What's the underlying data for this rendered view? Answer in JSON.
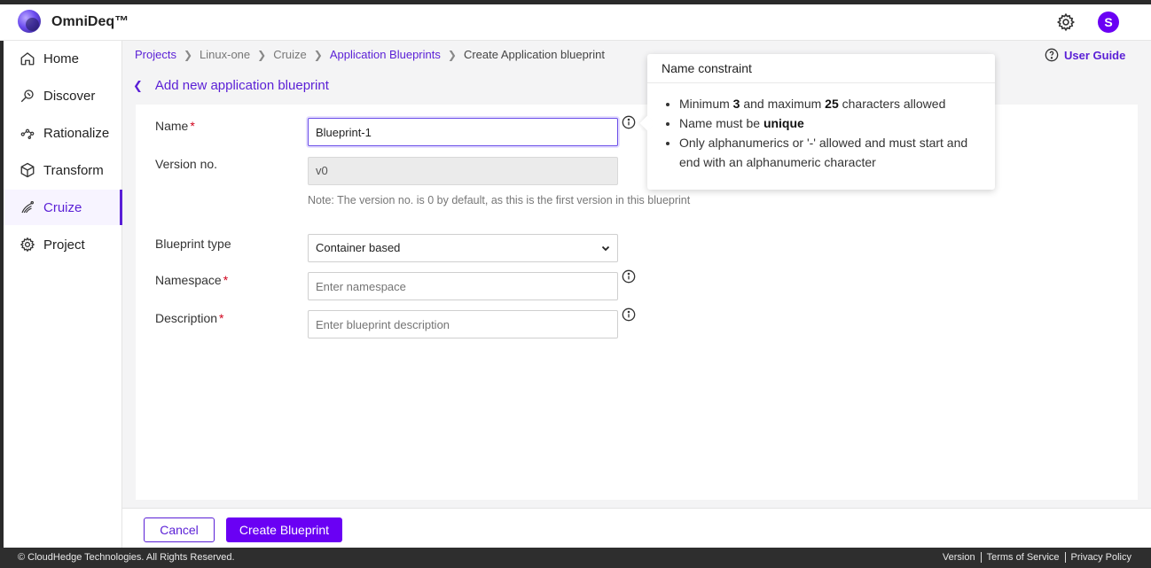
{
  "app": {
    "brand": "OmniDeq™",
    "avatar_initial": "S"
  },
  "sidebar": {
    "items": [
      {
        "label": "Home",
        "icon": "home-icon"
      },
      {
        "label": "Discover",
        "icon": "discover-icon"
      },
      {
        "label": "Rationalize",
        "icon": "rationalize-icon"
      },
      {
        "label": "Transform",
        "icon": "transform-icon"
      },
      {
        "label": "Cruize",
        "icon": "cruize-icon",
        "active": true
      },
      {
        "label": "Project",
        "icon": "gear-icon"
      }
    ]
  },
  "breadcrumb": {
    "items": [
      "Projects",
      "Linux-one",
      "Cruize",
      "Application Blueprints",
      "Create Application blueprint"
    ]
  },
  "user_guide": "User Guide",
  "page": {
    "back_title": "Add new application blueprint"
  },
  "form": {
    "name": {
      "label": "Name",
      "value": "Blueprint-1"
    },
    "version": {
      "label": "Version no.",
      "value": "v0",
      "note": "Note: The version no. is 0 by default, as this is the first version in this blueprint"
    },
    "blueprint_type": {
      "label": "Blueprint type",
      "value": "Container based"
    },
    "namespace": {
      "label": "Namespace",
      "placeholder": "Enter namespace"
    },
    "description": {
      "label": "Description",
      "placeholder": "Enter blueprint description"
    }
  },
  "tooltip": {
    "title": "Name constraint",
    "rule1": {
      "pre": "Minimum ",
      "b1": "3",
      "mid": " and maximum ",
      "b2": "25",
      "post": " characters allowed"
    },
    "rule2": {
      "pre": "Name must be ",
      "b1": "unique"
    },
    "rule3": "Only alphanumerics or '-' allowed and must start and end with an alphanumeric character"
  },
  "actions": {
    "cancel": "Cancel",
    "create": "Create Blueprint"
  },
  "footer": {
    "copyright": "© CloudHedge Technologies. All Rights Reserved.",
    "links": [
      "Version",
      "Terms of Service",
      "Privacy Policy"
    ]
  },
  "colors": {
    "accent": "#5a1fd6",
    "primary_button": "#6a00f4",
    "required": "#d0021b"
  }
}
